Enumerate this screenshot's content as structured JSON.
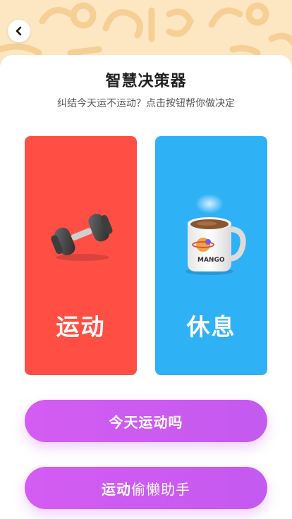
{
  "header": {
    "background_color": "#fde6c2",
    "back_icon": "chevron-left-icon"
  },
  "title": "智慧决策器",
  "subtitle": "纠结今天运不运动？点击按钮帮你做决定",
  "choices": [
    {
      "label": "运动",
      "icon": "dumbbell-icon",
      "color": "#ff4f45"
    },
    {
      "label": "休息",
      "icon": "coffee-mug-icon",
      "color": "#2fb1f6",
      "mug_text": "MANGO"
    }
  ],
  "buttons": {
    "ask_today": "今天运动吗",
    "lazy_helper_bold": "运动",
    "lazy_helper_rest": "偷懒助手",
    "color": "#d45cf2"
  }
}
